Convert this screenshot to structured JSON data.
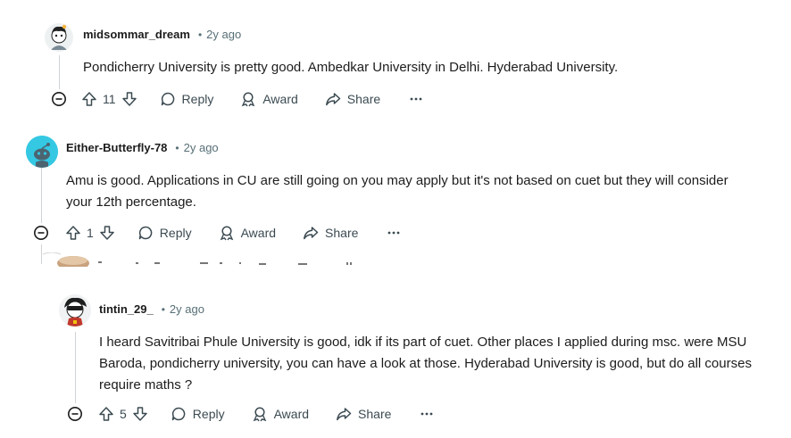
{
  "comments": [
    {
      "username": "midsommar_dream",
      "time": "2y ago",
      "body": "Pondicherry University is pretty good. Ambedkar University in Delhi. Hyderabad University.",
      "votes": "11",
      "reply": "Reply",
      "award": "Award",
      "share": "Share"
    },
    {
      "username": "Either-Butterfly-78",
      "time": "2y ago",
      "body": "Amu is good. Applications in CU are still going on you may apply but it's not based on cuet but they will consider your 12th percentage.",
      "votes": "1",
      "reply": "Reply",
      "award": "Award",
      "share": "Share"
    },
    {
      "username": "tintin_29_",
      "time": "2y ago",
      "body": "I heard Savitribai Phule University is good, idk if its part of cuet. Other places I applied during msc. were MSU Baroda, pondicherry university, you can have a look at those. Hyderabad University is good, but do all courses require maths ?",
      "votes": "5",
      "reply": "Reply",
      "award": "Award",
      "share": "Share"
    }
  ],
  "separator": "•",
  "colors": {
    "text": "#1c1c1c",
    "meta": "#576f76",
    "action": "#3b4a51",
    "line": "#d0d4d7",
    "snoo_bg": "#34c8e3"
  }
}
